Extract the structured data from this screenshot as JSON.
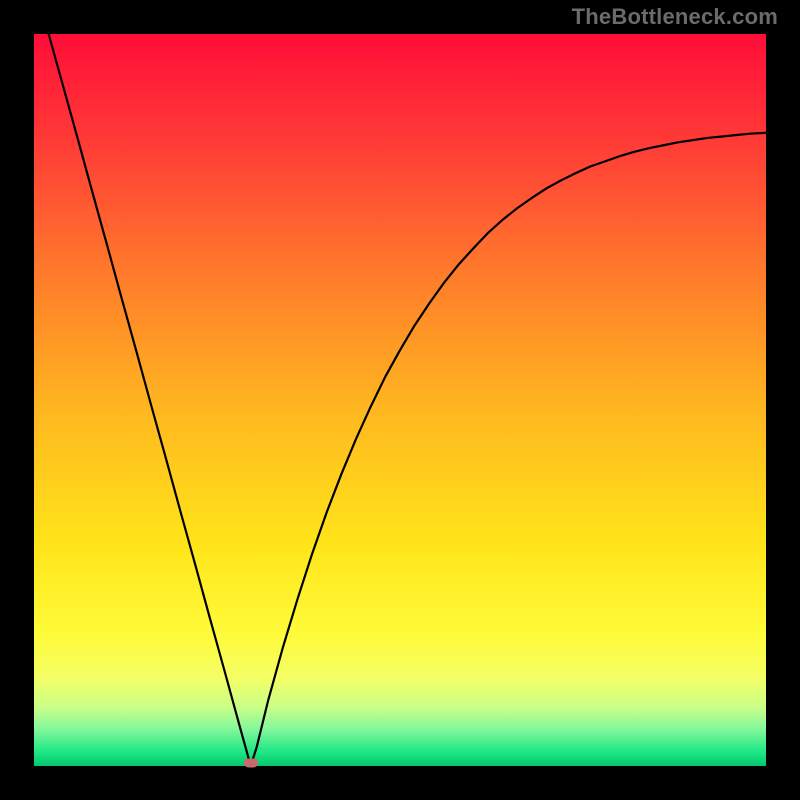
{
  "watermark": "TheBottleneck.com",
  "chart_data": {
    "type": "line",
    "title": "",
    "xlabel": "",
    "ylabel": "",
    "xlim": [
      0,
      100
    ],
    "ylim": [
      0,
      100
    ],
    "grid": false,
    "legend": false,
    "x": [
      2,
      4,
      6,
      8,
      10,
      12,
      14,
      16,
      18,
      20,
      22,
      24,
      26,
      28,
      29,
      29.6,
      30.4,
      32,
      34,
      36,
      38,
      40,
      42,
      44,
      46,
      48,
      50,
      52,
      54,
      56,
      58,
      60,
      62,
      64,
      66,
      68,
      70,
      72,
      74,
      76,
      78,
      80,
      82,
      84,
      86,
      88,
      90,
      92,
      94,
      96,
      98,
      100
    ],
    "values": [
      100,
      92.8,
      85.6,
      78.3,
      71.1,
      63.8,
      56.6,
      49.3,
      42.1,
      34.8,
      27.6,
      20.3,
      13.1,
      5.8,
      2.2,
      0.0,
      2.5,
      9.0,
      16.2,
      22.8,
      29.0,
      34.7,
      39.9,
      44.7,
      49.1,
      53.2,
      56.8,
      60.2,
      63.2,
      66.0,
      68.5,
      70.7,
      72.8,
      74.6,
      76.2,
      77.6,
      78.9,
      80.0,
      81.0,
      81.9,
      82.6,
      83.3,
      83.9,
      84.4,
      84.8,
      85.2,
      85.5,
      85.8,
      86.0,
      86.2,
      86.4,
      86.5
    ],
    "marker": {
      "x": 29.6,
      "y": 0.4,
      "color": "#c96a6a"
    },
    "background_gradient_stops": [
      {
        "pos": 0,
        "color": "#ff0d39"
      },
      {
        "pos": 16,
        "color": "#ff3f36"
      },
      {
        "pos": 34,
        "color": "#ff7f2a"
      },
      {
        "pos": 52,
        "color": "#ffb91f"
      },
      {
        "pos": 70,
        "color": "#ffe51a"
      },
      {
        "pos": 82,
        "color": "#fffb3a"
      },
      {
        "pos": 88,
        "color": "#f4ff66"
      },
      {
        "pos": 92,
        "color": "#c9ff88"
      },
      {
        "pos": 95,
        "color": "#82f79b"
      },
      {
        "pos": 98,
        "color": "#20e886"
      },
      {
        "pos": 100,
        "color": "#03c770"
      }
    ]
  }
}
